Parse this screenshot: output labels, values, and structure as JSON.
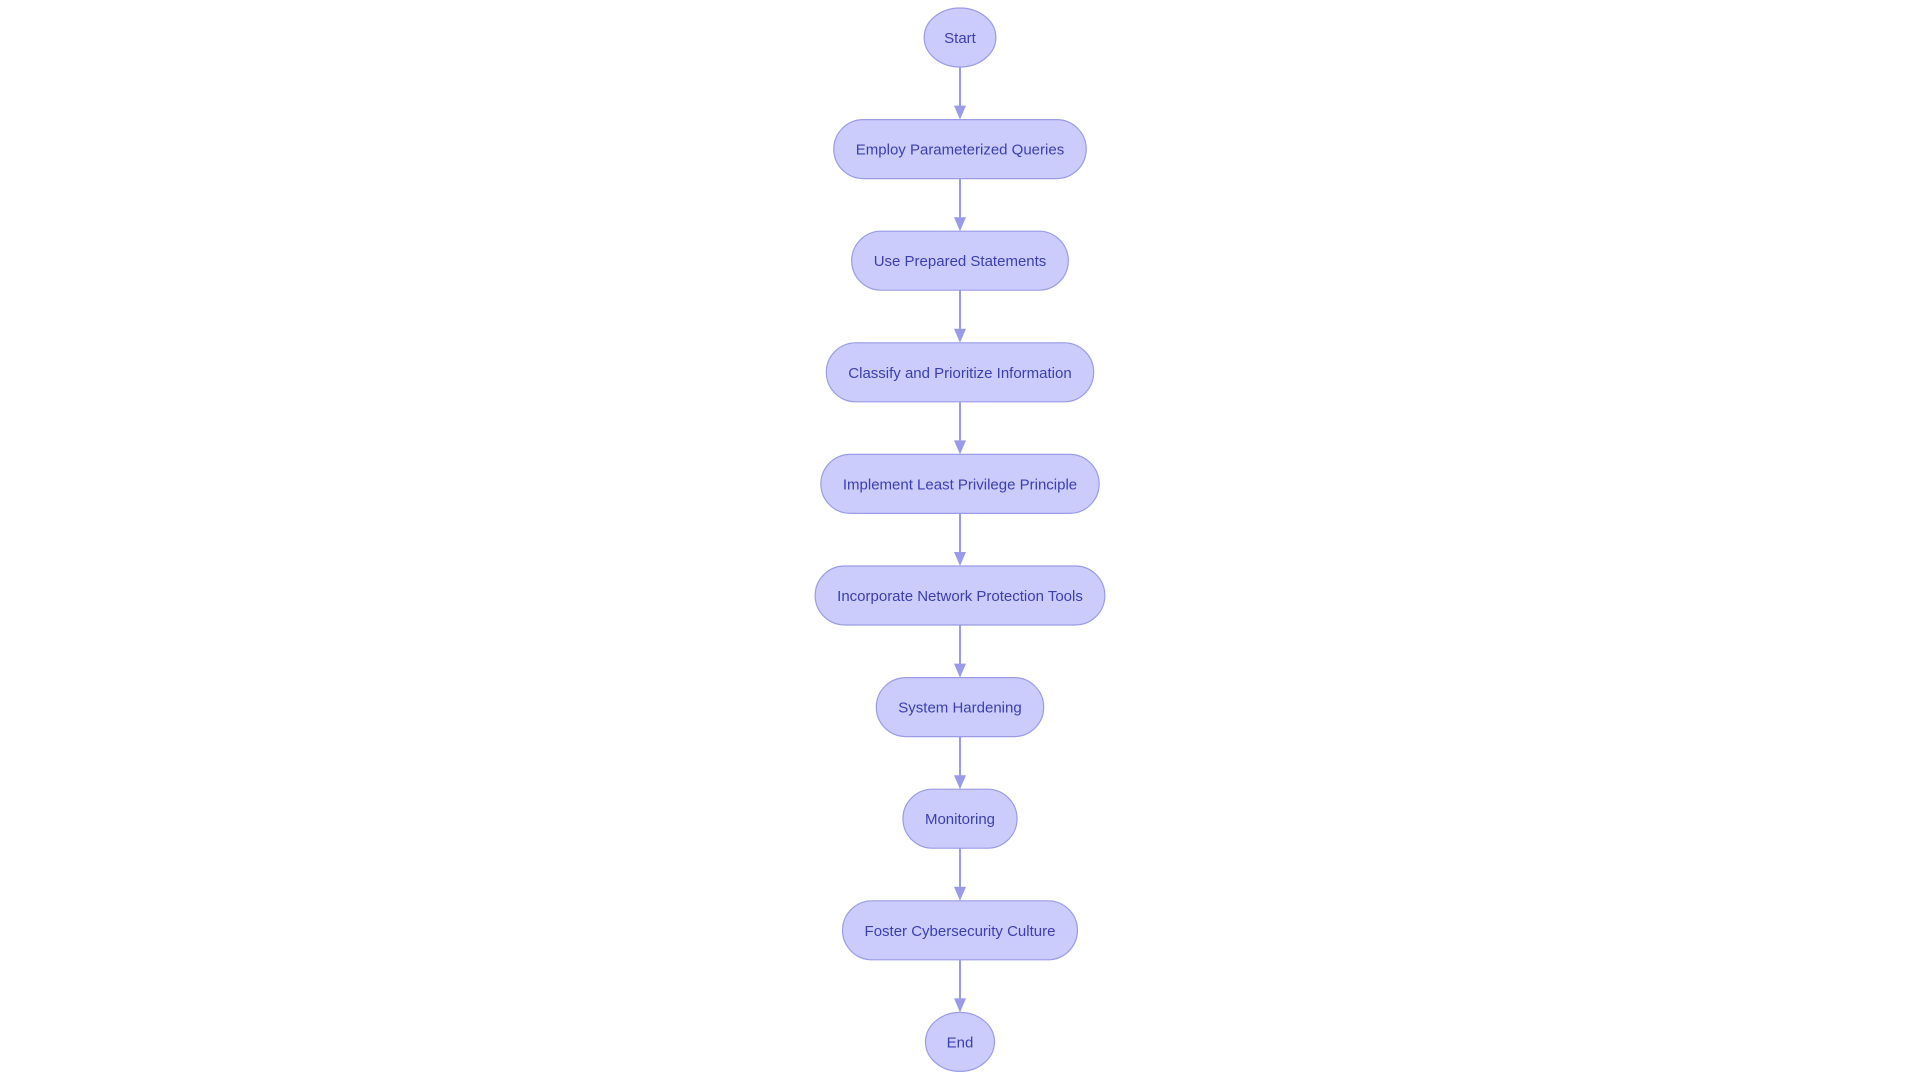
{
  "diagram": {
    "type": "flowchart",
    "direction": "top-to-bottom",
    "colors": {
      "node_fill": "#CBCCFB",
      "node_stroke": "#9A9CE6",
      "node_text": "#3B3FB0",
      "edge": "#999BE8"
    },
    "nodes": [
      {
        "id": "start",
        "label": "Start",
        "shape": "circle"
      },
      {
        "id": "employ",
        "label": "Employ Parameterized Queries",
        "shape": "stadium"
      },
      {
        "id": "prepared",
        "label": "Use Prepared Statements",
        "shape": "stadium"
      },
      {
        "id": "classify",
        "label": "Classify and Prioritize Information",
        "shape": "stadium"
      },
      {
        "id": "least",
        "label": "Implement Least Privilege Principle",
        "shape": "stadium"
      },
      {
        "id": "network",
        "label": "Incorporate Network Protection Tools",
        "shape": "stadium"
      },
      {
        "id": "hardening",
        "label": "System Hardening",
        "shape": "stadium"
      },
      {
        "id": "monitoring",
        "label": "Monitoring",
        "shape": "stadium"
      },
      {
        "id": "culture",
        "label": "Foster Cybersecurity Culture",
        "shape": "stadium"
      },
      {
        "id": "end",
        "label": "End",
        "shape": "circle"
      }
    ],
    "edges": [
      {
        "from": "start",
        "to": "employ"
      },
      {
        "from": "employ",
        "to": "prepared"
      },
      {
        "from": "prepared",
        "to": "classify"
      },
      {
        "from": "classify",
        "to": "least"
      },
      {
        "from": "least",
        "to": "network"
      },
      {
        "from": "network",
        "to": "hardening"
      },
      {
        "from": "hardening",
        "to": "monitoring"
      },
      {
        "from": "monitoring",
        "to": "culture"
      },
      {
        "from": "culture",
        "to": "end"
      }
    ]
  }
}
